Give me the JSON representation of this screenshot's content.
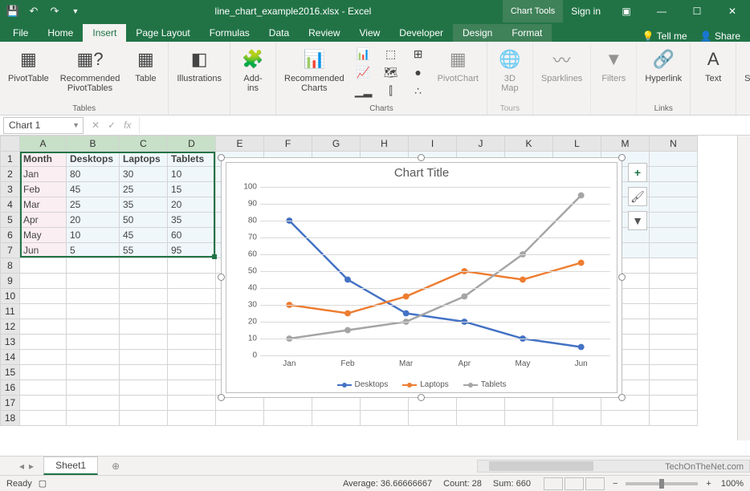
{
  "titlebar": {
    "filename": "line_chart_example2016.xlsx - Excel",
    "chart_tools": "Chart Tools",
    "sign_in": "Sign in"
  },
  "tabs": [
    "File",
    "Home",
    "Insert",
    "Page Layout",
    "Formulas",
    "Data",
    "Review",
    "View",
    "Developer"
  ],
  "tool_tabs": [
    "Design",
    "Format"
  ],
  "tellme": "Tell me",
  "share": "Share",
  "ribbon": {
    "tables": {
      "label": "Tables",
      "pivot": "PivotTable",
      "rec_pivot": "Recommended\nPivotTables",
      "table": "Table"
    },
    "illustrations": "Illustrations",
    "addins": "Add-\nins",
    "charts": {
      "label": "Charts",
      "rec": "Recommended\nCharts",
      "pivotchart": "PivotChart"
    },
    "tours": {
      "label": "Tours",
      "map": "3D\nMap"
    },
    "sparklines": "Sparklines",
    "filters": "Filters",
    "links": {
      "label": "Links",
      "hyperlink": "Hyperlink"
    },
    "text": "Text",
    "symbols": "Symbols"
  },
  "namebox": "Chart 1",
  "columns": [
    "A",
    "B",
    "C",
    "D",
    "E",
    "F",
    "G",
    "H",
    "I",
    "J",
    "K",
    "L",
    "M",
    "N"
  ],
  "rows_shown": 18,
  "table": {
    "headers": [
      "Month",
      "Desktops",
      "Laptops",
      "Tablets"
    ],
    "rows": [
      [
        "Jan",
        "80",
        "30",
        "10"
      ],
      [
        "Feb",
        "45",
        "25",
        "15"
      ],
      [
        "Mar",
        "25",
        "35",
        "20"
      ],
      [
        "Apr",
        "20",
        "50",
        "35"
      ],
      [
        "May",
        "10",
        "45",
        "60"
      ],
      [
        "Jun",
        "5",
        "55",
        "95"
      ]
    ]
  },
  "chart_data": {
    "type": "line",
    "title": "Chart Title",
    "categories": [
      "Jan",
      "Feb",
      "Mar",
      "Apr",
      "May",
      "Jun"
    ],
    "series": [
      {
        "name": "Desktops",
        "color": "#4472c4",
        "values": [
          80,
          45,
          25,
          20,
          10,
          5
        ]
      },
      {
        "name": "Laptops",
        "color": "#ed7d31",
        "values": [
          30,
          25,
          35,
          50,
          45,
          55
        ]
      },
      {
        "name": "Tablets",
        "color": "#a5a5a5",
        "values": [
          10,
          15,
          20,
          35,
          60,
          95
        ]
      }
    ],
    "ylim": [
      0,
      100
    ],
    "ytick": 10
  },
  "sheet_tab": "Sheet1",
  "statusbar": {
    "ready": "Ready",
    "avg_label": "Average:",
    "avg": "36.66666667",
    "count_label": "Count:",
    "count": "28",
    "sum_label": "Sum:",
    "sum": "660",
    "zoom": "100%"
  },
  "watermark": "TechOnTheNet.com"
}
